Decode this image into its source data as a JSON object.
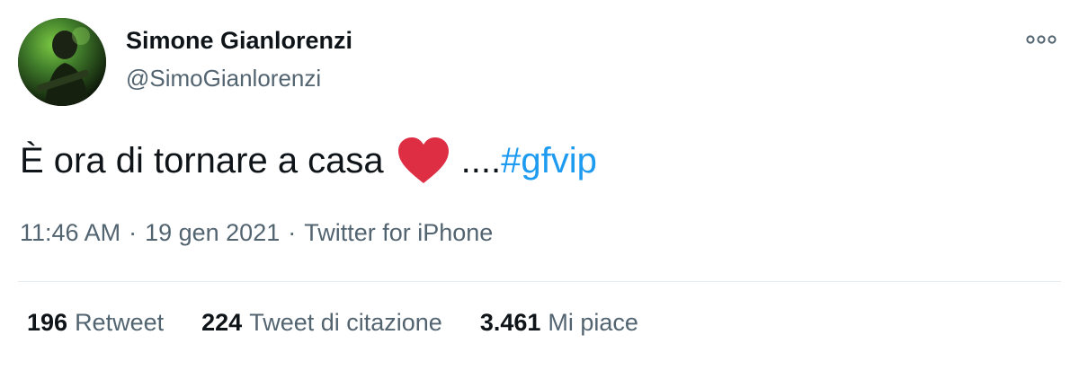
{
  "author": {
    "name": "Simone Gianlorenzi",
    "handle": "@SimoGianlorenzi"
  },
  "tweet": {
    "text_before": "È ora di tornare a casa",
    "emoji": "red-heart-emoji",
    "text_after": "....",
    "hashtag": "#gfvip"
  },
  "meta": {
    "time": "11:46 AM",
    "separator": "·",
    "date": "19 gen 2021",
    "source": "Twitter for iPhone"
  },
  "stats": [
    {
      "count": "196",
      "label": "Retweet"
    },
    {
      "count": "224",
      "label": "Tweet di citazione"
    },
    {
      "count": "3.461",
      "label": "Mi piace"
    }
  ],
  "colors": {
    "link": "#1d9bf0",
    "secondary_text": "#536471",
    "primary_text": "#0f1419",
    "heart": "#e0245e"
  },
  "icons": {
    "more": "more-options-icon"
  }
}
